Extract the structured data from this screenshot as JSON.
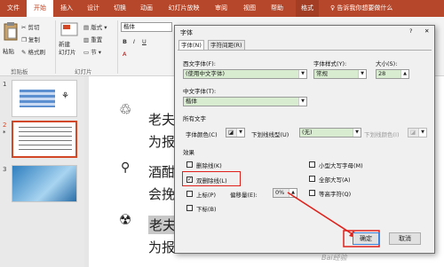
{
  "ribbon_tabs": [
    "文件",
    "开始",
    "插入",
    "设计",
    "切换",
    "动画",
    "幻灯片放映",
    "审阅",
    "视图",
    "帮助",
    "格式"
  ],
  "active_tab": "开始",
  "tell_me": "告诉我你想要做什么",
  "clipboard": {
    "paste": "粘贴",
    "cut": "剪切",
    "copy": "复制",
    "format_painter": "格式刷",
    "group": "剪贴板"
  },
  "slides_group": {
    "new_slide": "新建\n幻灯片",
    "layout": "版式",
    "reset": "重置",
    "section": "节",
    "group": "幻灯片"
  },
  "font_box_value": "楷体",
  "thumbnails": [
    {
      "num": "1"
    },
    {
      "num": "2"
    },
    {
      "num": "3"
    }
  ],
  "slide_text": [
    "老夫",
    "为报",
    "酒酣",
    "会挽",
    "老夫",
    "为报"
  ],
  "dialog": {
    "title": "字体",
    "help": "?",
    "close": "✕",
    "tabs": [
      "字体(N)",
      "字符间距(R)"
    ],
    "western_font_label": "西文字体(F):",
    "western_font_value": "(使用中文字体)",
    "style_label": "字体样式(Y):",
    "style_value": "常规",
    "size_label": "大小(S):",
    "size_value": "28",
    "asian_font_label": "中文字体(T):",
    "asian_font_value": "楷体",
    "all_text_label": "所有文字",
    "font_color_label": "字体颜色(C)",
    "underline_label": "下划线线型(U)",
    "underline_value": "(无)",
    "underline_color_label": "下划线颜色(I)",
    "effects_label": "效果",
    "effects_left": [
      {
        "label": "删除线(K)",
        "checked": false
      },
      {
        "label": "双删除线(L)",
        "checked": true
      },
      {
        "label": "上标(P)",
        "checked": false
      },
      {
        "label": "下标(B)",
        "checked": false
      }
    ],
    "effects_right": [
      {
        "label": "小型大写字母(M)",
        "checked": false
      },
      {
        "label": "全部大写(A)",
        "checked": false
      },
      {
        "label": "等高字符(Q)",
        "checked": false
      }
    ],
    "offset_label": "偏移量(E):",
    "offset_value": "0%",
    "ok": "确定",
    "cancel": "取消"
  },
  "colors": {
    "ribbon": "#b7472a",
    "highlight": "#e0201a"
  }
}
